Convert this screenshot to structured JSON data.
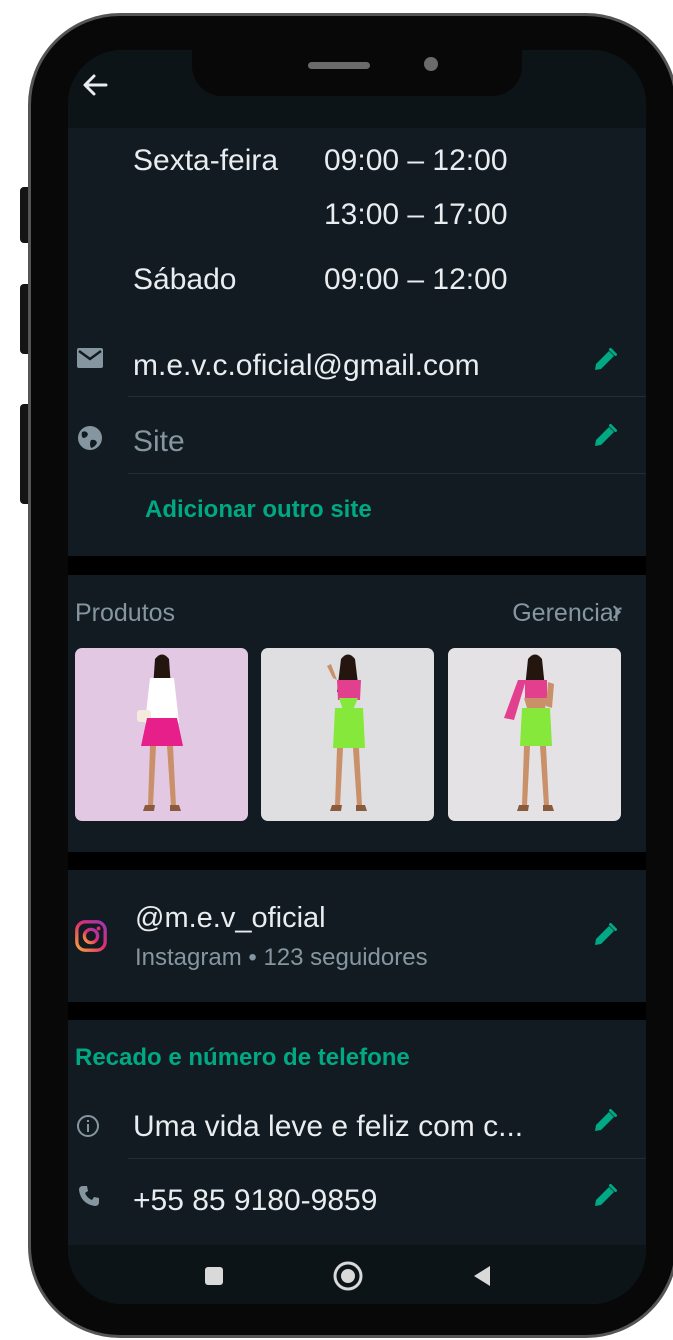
{
  "business_hours": {
    "rows": [
      {
        "day": "Sexta-feira",
        "time": "09:00 – 12:00"
      },
      {
        "day": "",
        "time": "13:00 – 17:00"
      },
      {
        "day": "Sábado",
        "time": "09:00 – 12:00"
      }
    ]
  },
  "contact": {
    "email": "m.e.v.c.oficial@gmail.com",
    "site_placeholder": "Site",
    "add_site_label": "Adicionar outro site"
  },
  "products": {
    "title": "Produtos",
    "manage_label": "Gerenciar",
    "items": [
      {
        "bg": "#e3c8e3",
        "top": "#ffffff",
        "bottom": "#e61f8a"
      },
      {
        "bg": "#dfdfe2",
        "top": "#e23f8f",
        "bottom": "#86e83a"
      },
      {
        "bg": "#e4e2e5",
        "top": "#e23f8f",
        "bottom": "#86e83a"
      }
    ]
  },
  "instagram": {
    "handle": "@m.e.v_oficial",
    "subtitle": "Instagram • 123 seguidores"
  },
  "about_phone": {
    "section_title": "Recado e número de telefone",
    "about": "Uma vida leve e feliz com c...",
    "phone": "+55 85 9180-9859"
  },
  "colors": {
    "background": "#111b21",
    "accent": "#00a884",
    "text_primary": "#e9edef",
    "text_secondary": "#8696a0"
  },
  "icons": {
    "back": "arrow-left-icon",
    "email": "envelope-icon",
    "site": "globe-icon",
    "edit": "pencil-icon",
    "instagram": "instagram-icon",
    "about": "info-icon",
    "phone": "phone-icon"
  }
}
